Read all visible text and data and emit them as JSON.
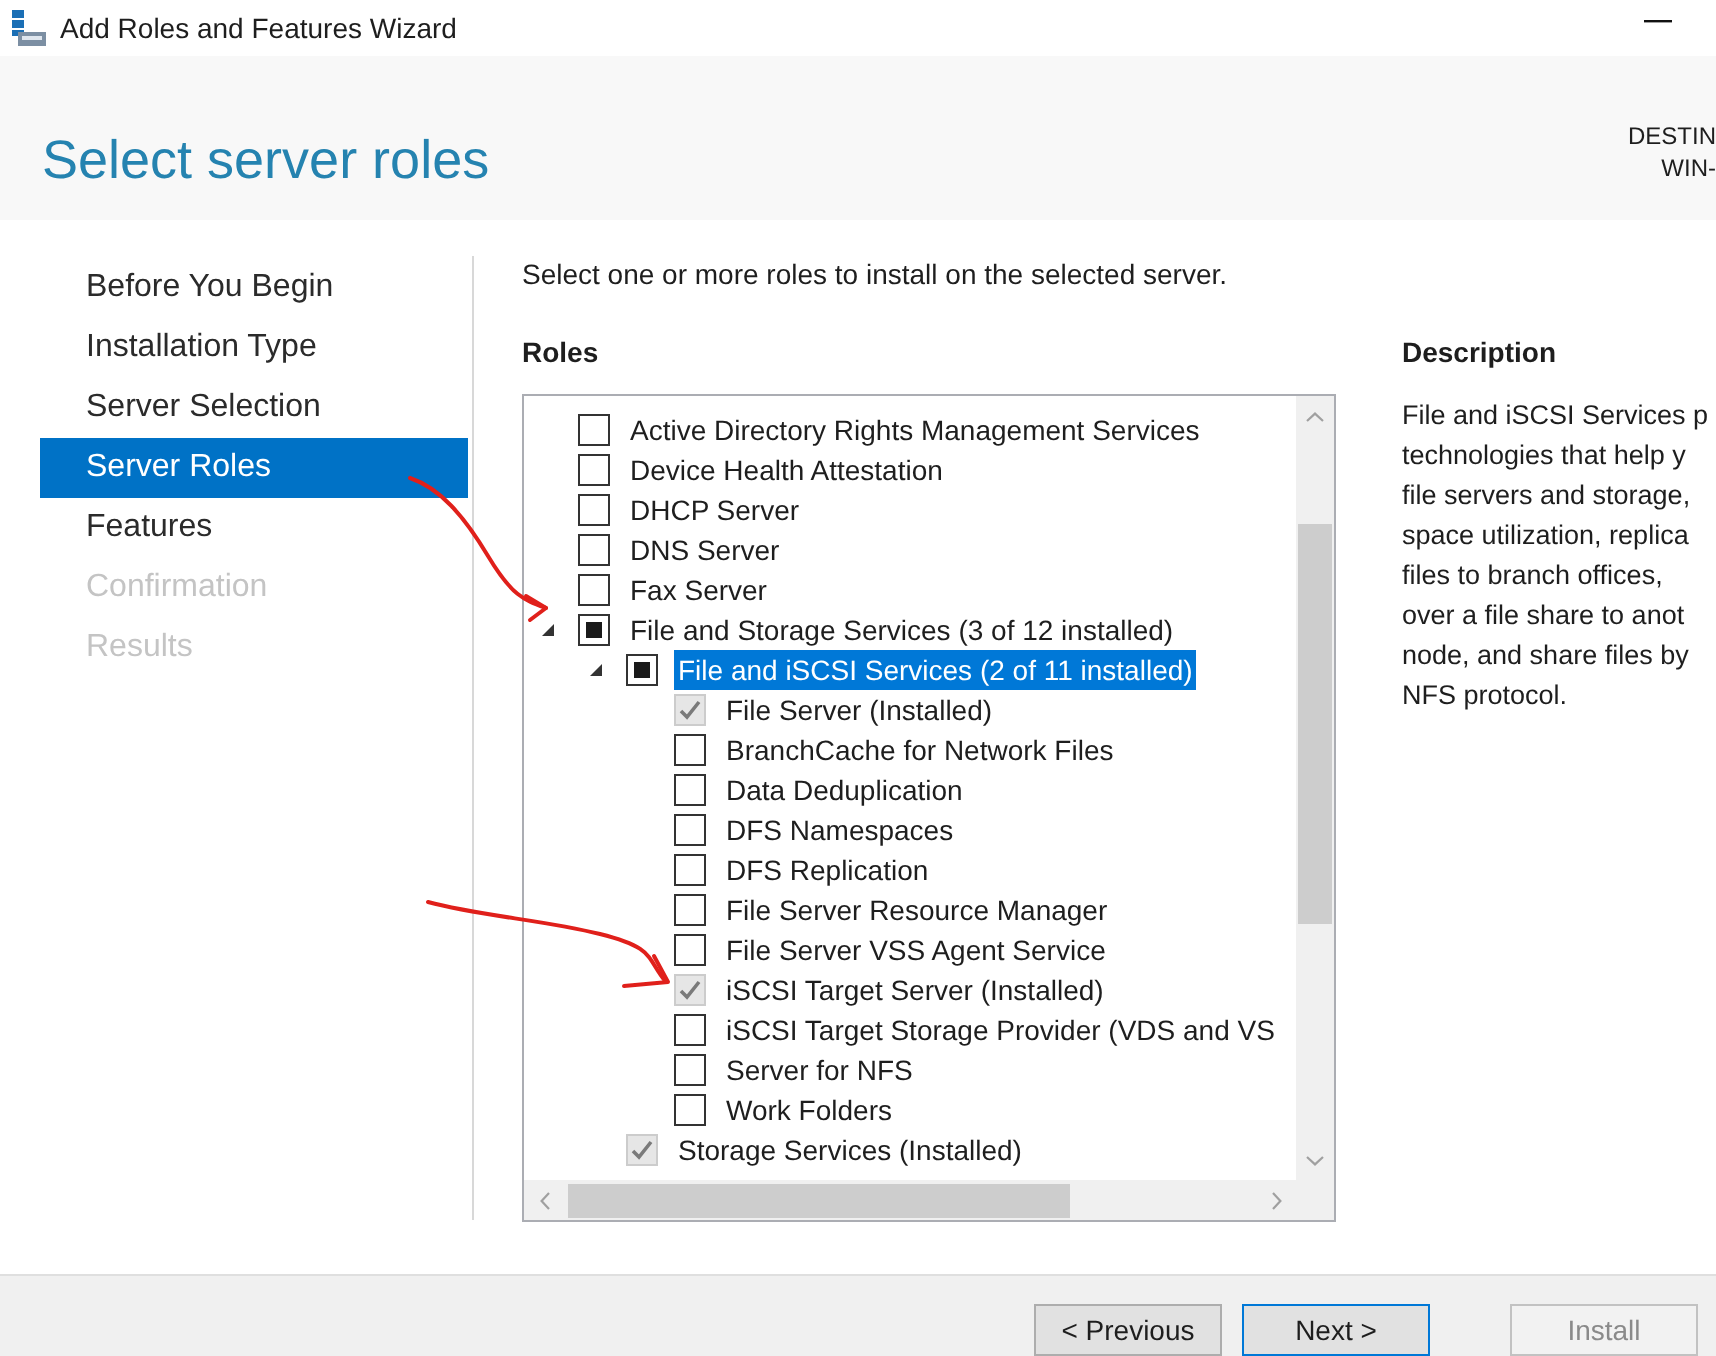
{
  "window": {
    "title": "Add Roles and Features Wizard"
  },
  "header": {
    "title": "Select server roles",
    "destination_label": "DESTIN",
    "destination_server": "WIN-"
  },
  "steps": [
    {
      "label": "Before You Begin",
      "selected": false,
      "disabled": false
    },
    {
      "label": "Installation Type",
      "selected": false,
      "disabled": false
    },
    {
      "label": "Server Selection",
      "selected": false,
      "disabled": false
    },
    {
      "label": "Server Roles",
      "selected": true,
      "disabled": false
    },
    {
      "label": "Features",
      "selected": false,
      "disabled": false
    },
    {
      "label": "Confirmation",
      "selected": false,
      "disabled": true
    },
    {
      "label": "Results",
      "selected": false,
      "disabled": true
    }
  ],
  "instruction": "Select one or more roles to install on the selected server.",
  "roles": {
    "heading": "Roles",
    "items": [
      {
        "label": "Active Directory Rights Management Services",
        "checked": false,
        "partial": false,
        "disabled": false,
        "selected": false
      },
      {
        "label": "Device Health Attestation",
        "checked": false,
        "partial": false,
        "disabled": false,
        "selected": false
      },
      {
        "label": "DHCP Server",
        "checked": false,
        "partial": false,
        "disabled": false,
        "selected": false
      },
      {
        "label": "DNS Server",
        "checked": false,
        "partial": false,
        "disabled": false,
        "selected": false
      },
      {
        "label": "Fax Server",
        "checked": false,
        "partial": false,
        "disabled": false,
        "selected": false
      },
      {
        "label": "File and Storage Services (3 of 12 installed)",
        "checked": false,
        "partial": true,
        "disabled": false,
        "selected": false,
        "expanded": true,
        "children": [
          {
            "label": "File and iSCSI Services (2 of 11 installed)",
            "checked": false,
            "partial": true,
            "disabled": false,
            "selected": true,
            "expanded": true,
            "children": [
              {
                "label": "File Server (Installed)",
                "checked": true,
                "partial": false,
                "disabled": true,
                "selected": false
              },
              {
                "label": "BranchCache for Network Files",
                "checked": false,
                "partial": false,
                "disabled": false,
                "selected": false
              },
              {
                "label": "Data Deduplication",
                "checked": false,
                "partial": false,
                "disabled": false,
                "selected": false
              },
              {
                "label": "DFS Namespaces",
                "checked": false,
                "partial": false,
                "disabled": false,
                "selected": false
              },
              {
                "label": "DFS Replication",
                "checked": false,
                "partial": false,
                "disabled": false,
                "selected": false
              },
              {
                "label": "File Server Resource Manager",
                "checked": false,
                "partial": false,
                "disabled": false,
                "selected": false
              },
              {
                "label": "File Server VSS Agent Service",
                "checked": false,
                "partial": false,
                "disabled": false,
                "selected": false
              },
              {
                "label": "iSCSI Target Server (Installed)",
                "checked": true,
                "partial": false,
                "disabled": true,
                "selected": false
              },
              {
                "label": "iSCSI Target Storage Provider (VDS and VS",
                "checked": false,
                "partial": false,
                "disabled": false,
                "selected": false
              },
              {
                "label": "Server for NFS",
                "checked": false,
                "partial": false,
                "disabled": false,
                "selected": false
              },
              {
                "label": "Work Folders",
                "checked": false,
                "partial": false,
                "disabled": false,
                "selected": false
              }
            ]
          },
          {
            "label": "Storage Services (Installed)",
            "checked": true,
            "partial": false,
            "disabled": true,
            "selected": false
          }
        ]
      }
    ]
  },
  "description": {
    "heading": "Description",
    "lines": [
      "File and iSCSI Services p",
      "technologies that help y",
      "file servers and storage,",
      "space utilization, replica",
      "files to branch offices,",
      "over a file share to anot",
      "node, and share files by",
      "NFS protocol."
    ]
  },
  "buttons": [
    {
      "label": "< Previous",
      "disabled": false,
      "focused": false
    },
    {
      "label": "Next >",
      "disabled": false,
      "focused": true
    },
    {
      "label": "Install",
      "disabled": true,
      "focused": false
    }
  ]
}
